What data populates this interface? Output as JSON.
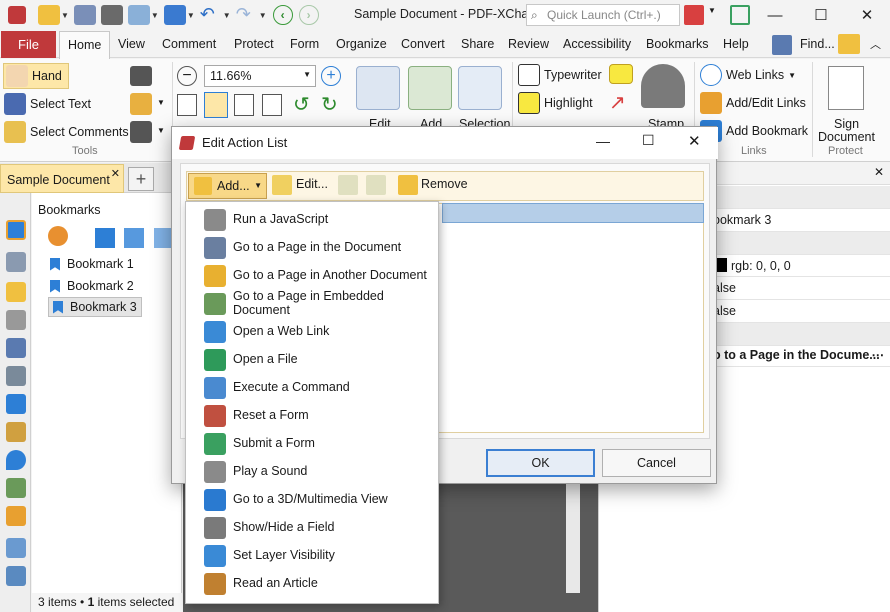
{
  "window": {
    "title": "Sample Document - PDF-XCha...",
    "search_placeholder": "Quick Launch (Ctrl+.)"
  },
  "menubar": {
    "file": "File",
    "tabs": [
      "Home",
      "View",
      "Comment",
      "Protect",
      "Form",
      "Organize",
      "Convert",
      "Share",
      "Review",
      "Accessibility",
      "Bookmarks",
      "Help"
    ],
    "find": "Find..."
  },
  "ribbon": {
    "hand": "Hand",
    "select_text": "Select Text",
    "select_comments": "Select Comments",
    "tools_group": "Tools",
    "zoom": "11.66%",
    "edit": "Edit",
    "add": "Add",
    "selection": "Selection",
    "typewriter": "Typewriter",
    "highlight": "Highlight",
    "stamp": "Stamp",
    "web_links": "Web Links",
    "add_edit_links": "Add/Edit Links",
    "add_bookmark": "Add Bookmark",
    "links_group": "Links",
    "sign_document_1": "Sign",
    "sign_document_2": "Document",
    "protect_group": "Protect"
  },
  "doc_tab": "Sample Document",
  "bookmarks": {
    "header": "Bookmarks",
    "items": [
      "Bookmark 1",
      "Bookmark 2",
      "Bookmark 3"
    ],
    "status_count": "3 items",
    "status_selected_num": "1",
    "status_selected_text": "items selected"
  },
  "properties": {
    "title_value": "ookmark 3",
    "color_value": "rgb: 0, 0, 0",
    "bold_value": "alse",
    "italic_value": "alse",
    "action_value": "o to a Page in the Docume..."
  },
  "dialog": {
    "title": "Edit Action List",
    "add": "Add...",
    "edit": "Edit...",
    "remove": "Remove",
    "ok": "OK",
    "cancel": "Cancel"
  },
  "menu_items": [
    {
      "label": "Run a JavaScript",
      "icon": "javascript-icon",
      "color": "#8a8a8a"
    },
    {
      "label": "Go to a Page in the Document",
      "icon": "goto-page-icon",
      "color": "#6a7fa0"
    },
    {
      "label": "Go to a Page in Another Document",
      "icon": "goto-other-doc-icon",
      "color": "#e8b030"
    },
    {
      "label": "Go to a Page in Embedded Document",
      "icon": "goto-embedded-doc-icon",
      "color": "#6a9a5a"
    },
    {
      "label": "Open a Web Link",
      "icon": "web-link-icon",
      "color": "#3a8ad6"
    },
    {
      "label": "Open a File",
      "icon": "open-file-icon",
      "color": "#2e9a5a"
    },
    {
      "label": "Execute a Command",
      "icon": "command-icon",
      "color": "#4a8ad0"
    },
    {
      "label": "Reset a Form",
      "icon": "reset-form-icon",
      "color": "#c05040"
    },
    {
      "label": "Submit a Form",
      "icon": "submit-form-icon",
      "color": "#3aa060"
    },
    {
      "label": "Play a Sound",
      "icon": "sound-icon",
      "color": "#8a8a8a"
    },
    {
      "label": "Go to a 3D/Multimedia View",
      "icon": "3d-view-icon",
      "color": "#2a7ad0"
    },
    {
      "label": "Show/Hide a Field",
      "icon": "show-hide-field-icon",
      "color": "#7a7a7a"
    },
    {
      "label": "Set Layer Visibility",
      "icon": "layer-visibility-icon",
      "color": "#3a8ad6"
    },
    {
      "label": "Read an Article",
      "icon": "article-icon",
      "color": "#c08030"
    }
  ],
  "colors": {
    "file_tab": "#c0393b",
    "accent_blue": "#2d7fd6",
    "selection": "#b5cee8"
  }
}
